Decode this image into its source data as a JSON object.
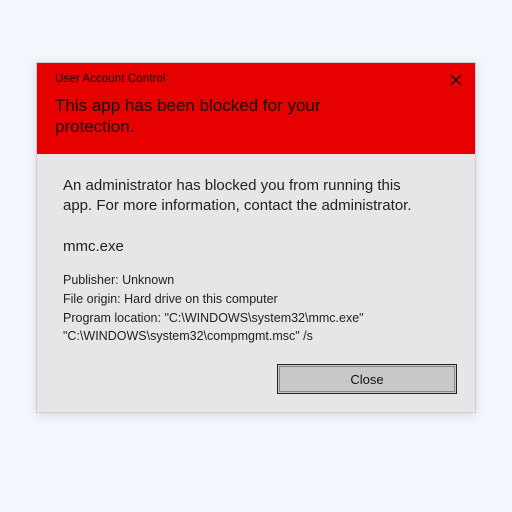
{
  "dialog": {
    "title": "User Account Control",
    "heading": "This app has been blocked for your protection.",
    "body_message": "An administrator has blocked you from running this app. For more information, contact the administrator.",
    "app_name": "mmc.exe",
    "details": {
      "publisher_label": "Publisher:",
      "publisher_value": "Unknown",
      "origin_label": "File origin:",
      "origin_value": "Hard drive on this computer",
      "location_label": "Program location:",
      "location_value": "\"C:\\WINDOWS\\system32\\mmc.exe\" \"C:\\WINDOWS\\system32\\compmgmt.msc\" /s"
    },
    "close_button_label": "Close"
  },
  "colors": {
    "header_bg": "#e60000",
    "body_bg": "#e6e6e6",
    "stage_bg": "#f3f7fd"
  }
}
